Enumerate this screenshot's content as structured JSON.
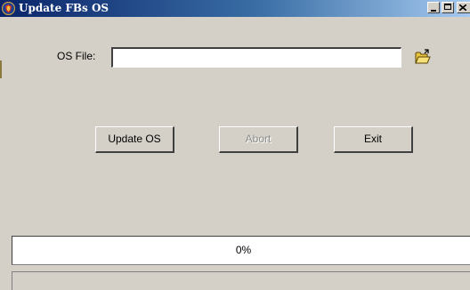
{
  "window": {
    "title": "Update FBs OS",
    "icons": {
      "app": "app-shield-icon",
      "minimize": "minimize-icon",
      "maximize": "maximize-icon",
      "close": "close-icon",
      "browse": "open-folder-icon"
    }
  },
  "form": {
    "os_file_label": "OS File:",
    "os_file_value": "",
    "os_file_placeholder": ""
  },
  "buttons": {
    "update_label": "Update OS",
    "abort_label": "Abort",
    "exit_label": "Exit",
    "abort_enabled": false
  },
  "progress": {
    "text": "0%",
    "value": 0
  },
  "status": {
    "text": ""
  },
  "colors": {
    "window_bg": "#d4d0c8",
    "title_gradient_start": "#0a246a",
    "title_gradient_end": "#a6caf0",
    "disabled_text": "#8c8c8c"
  }
}
